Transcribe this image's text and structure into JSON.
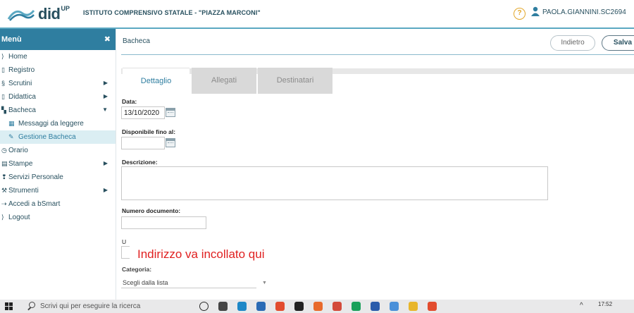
{
  "header": {
    "logo_text": "did",
    "logo_sup": "UP",
    "school": "ISTITUTO COMPRENSIVO STATALE - \"PIAZZA MARCONI\"",
    "help_symbol": "?",
    "user": "PAOLA.GIANNINI.SC2694"
  },
  "sidebar": {
    "title": "Menù",
    "close_symbol": "✖",
    "items": [
      {
        "label": "Home",
        "icon": "home-icon"
      },
      {
        "label": "Registro",
        "icon": "book-icon"
      },
      {
        "label": "Scrutini",
        "icon": "ribbon-icon"
      },
      {
        "label": "Didattica",
        "icon": "folder-icon"
      },
      {
        "label": "Bacheca",
        "icon": "board-icon"
      },
      {
        "label": "Messaggi da leggere",
        "icon": "table-icon"
      },
      {
        "label": "Gestione Bacheca",
        "icon": "edit-icon"
      },
      {
        "label": "Orario",
        "icon": "clock-icon"
      },
      {
        "label": "Stampe",
        "icon": "print-icon"
      },
      {
        "label": "Servizi Personale",
        "icon": "person-icon"
      },
      {
        "label": "Strumenti",
        "icon": "tools-icon"
      },
      {
        "label": "Accedi a bSmart",
        "icon": "link-icon"
      },
      {
        "label": "Logout",
        "icon": "logout-icon"
      }
    ]
  },
  "main": {
    "breadcrumb": "Bacheca",
    "back_label": "Indietro",
    "save_label": "Salva",
    "tabs": [
      "Dettaglio",
      "Allegati",
      "Destinatari"
    ],
    "form": {
      "date_label": "Data:",
      "date_value": "13/10/2020",
      "until_label": "Disponibile fino al:",
      "description_label": "Descrizione:",
      "number_label": "Numero documento:",
      "url_label_partial": "U",
      "category_label": "Categoria:",
      "category_placeholder": "Scegli dalla lista"
    },
    "overlay_note": "Indirizzo va incollato qui"
  },
  "taskbar": {
    "search_placeholder": "Scrivi qui per eseguire la ricerca",
    "time": "17:52",
    "tray_symbol": "^",
    "app_colors": [
      "#2c2c2c",
      "#444",
      "#1e88c7",
      "#2a6bb5",
      "#e24c2e",
      "#222",
      "#e86a2b",
      "#d34a3a",
      "#1aa05a",
      "#2a5cab",
      "#4a90d9",
      "#e8b62b",
      "#e24c2e"
    ]
  },
  "colors": {
    "accent": "#2f7ea0",
    "overlay_note": "#e02020",
    "help": "#e2a72b"
  }
}
